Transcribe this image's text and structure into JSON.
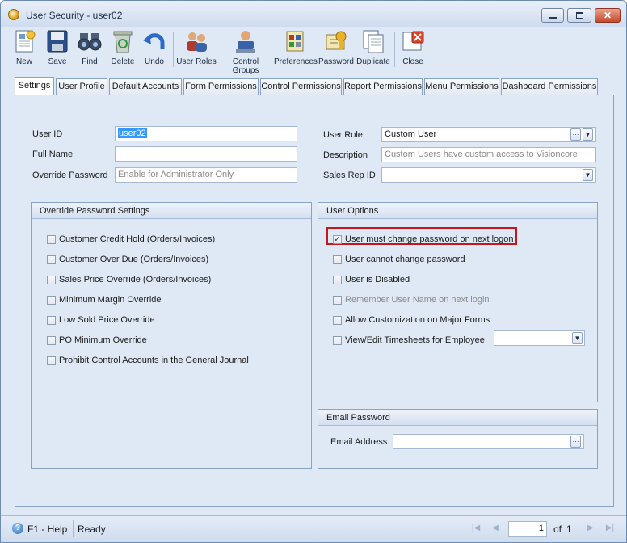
{
  "window": {
    "title": "User Security - user02"
  },
  "toolbar": {
    "new": "New",
    "save": "Save",
    "find": "Find",
    "delete": "Delete",
    "undo": "Undo",
    "user_roles": "User Roles",
    "control_groups": "Control Groups",
    "preferences": "Preferences",
    "password": "Password",
    "duplicate": "Duplicate",
    "close": "Close"
  },
  "tabs": [
    "Settings",
    "User Profile",
    "Default Accounts",
    "Form Permissions",
    "Control Permissions",
    "Report Permissions",
    "Menu Permissions",
    "Dashboard Permissions"
  ],
  "form": {
    "user_id_label": "User ID",
    "user_id_value": "user02",
    "full_name_label": "Full Name",
    "full_name_value": "",
    "override_password_label": "Override Password",
    "override_password_placeholder": "Enable for Administrator Only",
    "user_role_label": "User Role",
    "user_role_value": "Custom User",
    "description_label": "Description",
    "description_value": "Custom Users have custom access to Visioncore",
    "sales_rep_label": "Sales Rep ID",
    "sales_rep_value": ""
  },
  "override_settings": {
    "title": "Override Password Settings",
    "items": [
      "Customer Credit Hold (Orders/Invoices)",
      "Customer Over Due (Orders/Invoices)",
      "Sales Price Override (Orders/Invoices)",
      "Minimum Margin Override",
      "Low Sold Price Override",
      "PO Minimum Override",
      "Prohibit Control Accounts in the General Journal"
    ]
  },
  "user_options": {
    "title": "User Options",
    "items": [
      "User must change password on next logon",
      "User cannot change password",
      "User is Disabled",
      "Remember User Name on next login",
      "Allow Customization on Major Forms",
      "View/Edit Timesheets for Employee"
    ],
    "checked_mark": "✓"
  },
  "email_password": {
    "title": "Email Password",
    "label": "Email Address",
    "value": ""
  },
  "status": {
    "help": "F1 - Help",
    "state": "Ready",
    "page": "1",
    "of_label": "of",
    "total": "1"
  },
  "glyphs": {
    "ellipsis": "···",
    "dropdown": "▼"
  },
  "colors": {
    "highlight": "#c4161c",
    "selection": "#3399ff"
  }
}
